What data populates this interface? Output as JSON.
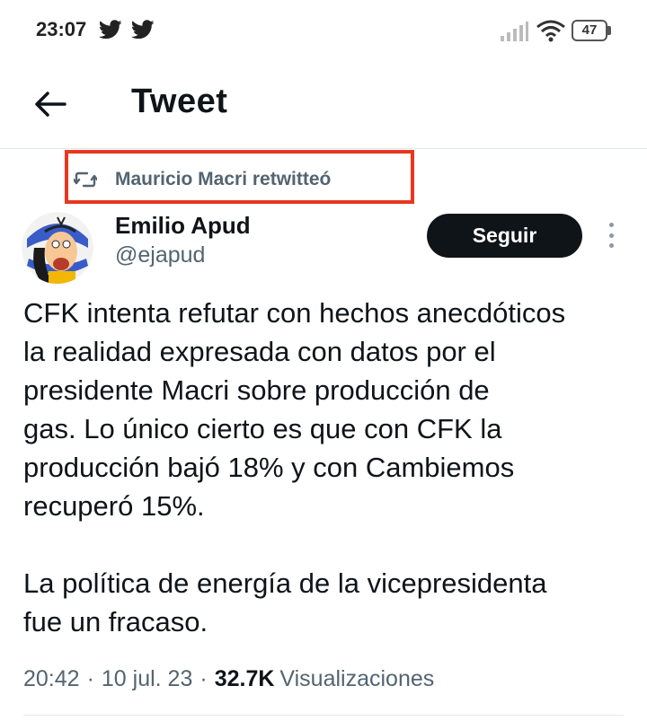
{
  "status_bar": {
    "time": "23:07",
    "battery": "47",
    "icons": [
      "twitter-bird-icon",
      "twitter-bird-icon",
      "signal-icon",
      "wifi-icon",
      "battery-icon"
    ]
  },
  "header": {
    "title": "Tweet",
    "back_icon": "back-arrow-icon"
  },
  "retweet": {
    "icon": "retweet-icon",
    "text": "Mauricio Macri retwitteó",
    "highlight_color": "#e8371e"
  },
  "author": {
    "name": "Emilio Apud",
    "handle": "@ejapud",
    "avatar": "cartoon-avatar"
  },
  "follow_button": {
    "label": "Seguir"
  },
  "tweet": {
    "text": "CFK intenta refutar con hechos anecdóticos\nla realidad expresada con datos por el\npresidente Macri sobre producción de\ngas. Lo único cierto es que con CFK la\nproducción bajó 18% y con Cambiemos\nrecuperó 15%.\n\nLa política de energía de la vicepresidenta\nfue un fracaso."
  },
  "meta": {
    "time": "20:42",
    "separator": "·",
    "date": "10 jul. 23",
    "views_count": "32.7K",
    "views_label": "Visualizaciones"
  },
  "colors": {
    "primary_text": "#0f1419",
    "secondary_text": "#536471",
    "button_bg": "#0f1419"
  }
}
